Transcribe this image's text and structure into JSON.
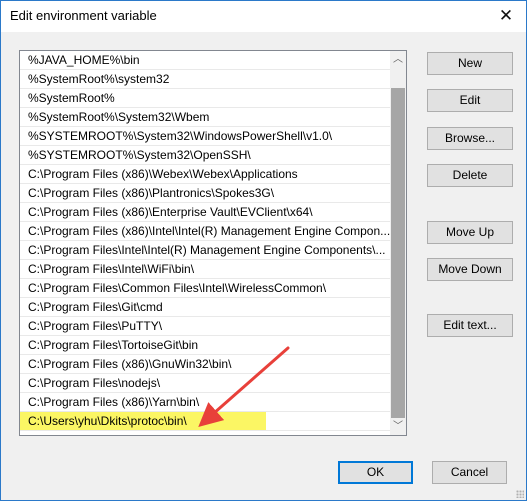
{
  "window": {
    "title": "Edit environment variable",
    "close_glyph": "✕"
  },
  "list": {
    "items": [
      "%JAVA_HOME%\\bin",
      "%SystemRoot%\\system32",
      "%SystemRoot%",
      "%SystemRoot%\\System32\\Wbem",
      "%SYSTEMROOT%\\System32\\WindowsPowerShell\\v1.0\\",
      "%SYSTEMROOT%\\System32\\OpenSSH\\",
      "C:\\Program Files (x86)\\Webex\\Webex\\Applications",
      "C:\\Program Files (x86)\\Plantronics\\Spokes3G\\",
      "C:\\Program Files (x86)\\Enterprise Vault\\EVClient\\x64\\",
      "C:\\Program Files (x86)\\Intel\\Intel(R) Management Engine Compon...",
      "C:\\Program Files\\Intel\\Intel(R) Management Engine Components\\...",
      "C:\\Program Files\\Intel\\WiFi\\bin\\",
      "C:\\Program Files\\Common Files\\Intel\\WirelessCommon\\",
      "C:\\Program Files\\Git\\cmd",
      "C:\\Program Files\\PuTTY\\",
      "C:\\Program Files\\TortoiseGit\\bin",
      "C:\\Program Files (x86)\\GnuWin32\\bin\\",
      "C:\\Program Files\\nodejs\\",
      "C:\\Program Files (x86)\\Yarn\\bin\\",
      "C:\\Users\\yhu\\Dkits\\protoc\\bin\\"
    ],
    "highlighted_index": 19,
    "highlight_color": "#fbf664",
    "scroll_up_glyph": "︿",
    "scroll_down_glyph": "﹀"
  },
  "buttons": {
    "new": "New",
    "edit": "Edit",
    "browse": "Browse...",
    "delete": "Delete",
    "move_up": "Move Up",
    "move_down": "Move Down",
    "edit_text": "Edit text...",
    "ok": "OK",
    "cancel": "Cancel"
  },
  "annotation": {
    "type": "arrow",
    "color": "#e8403a",
    "points_to_item_index": 19
  }
}
